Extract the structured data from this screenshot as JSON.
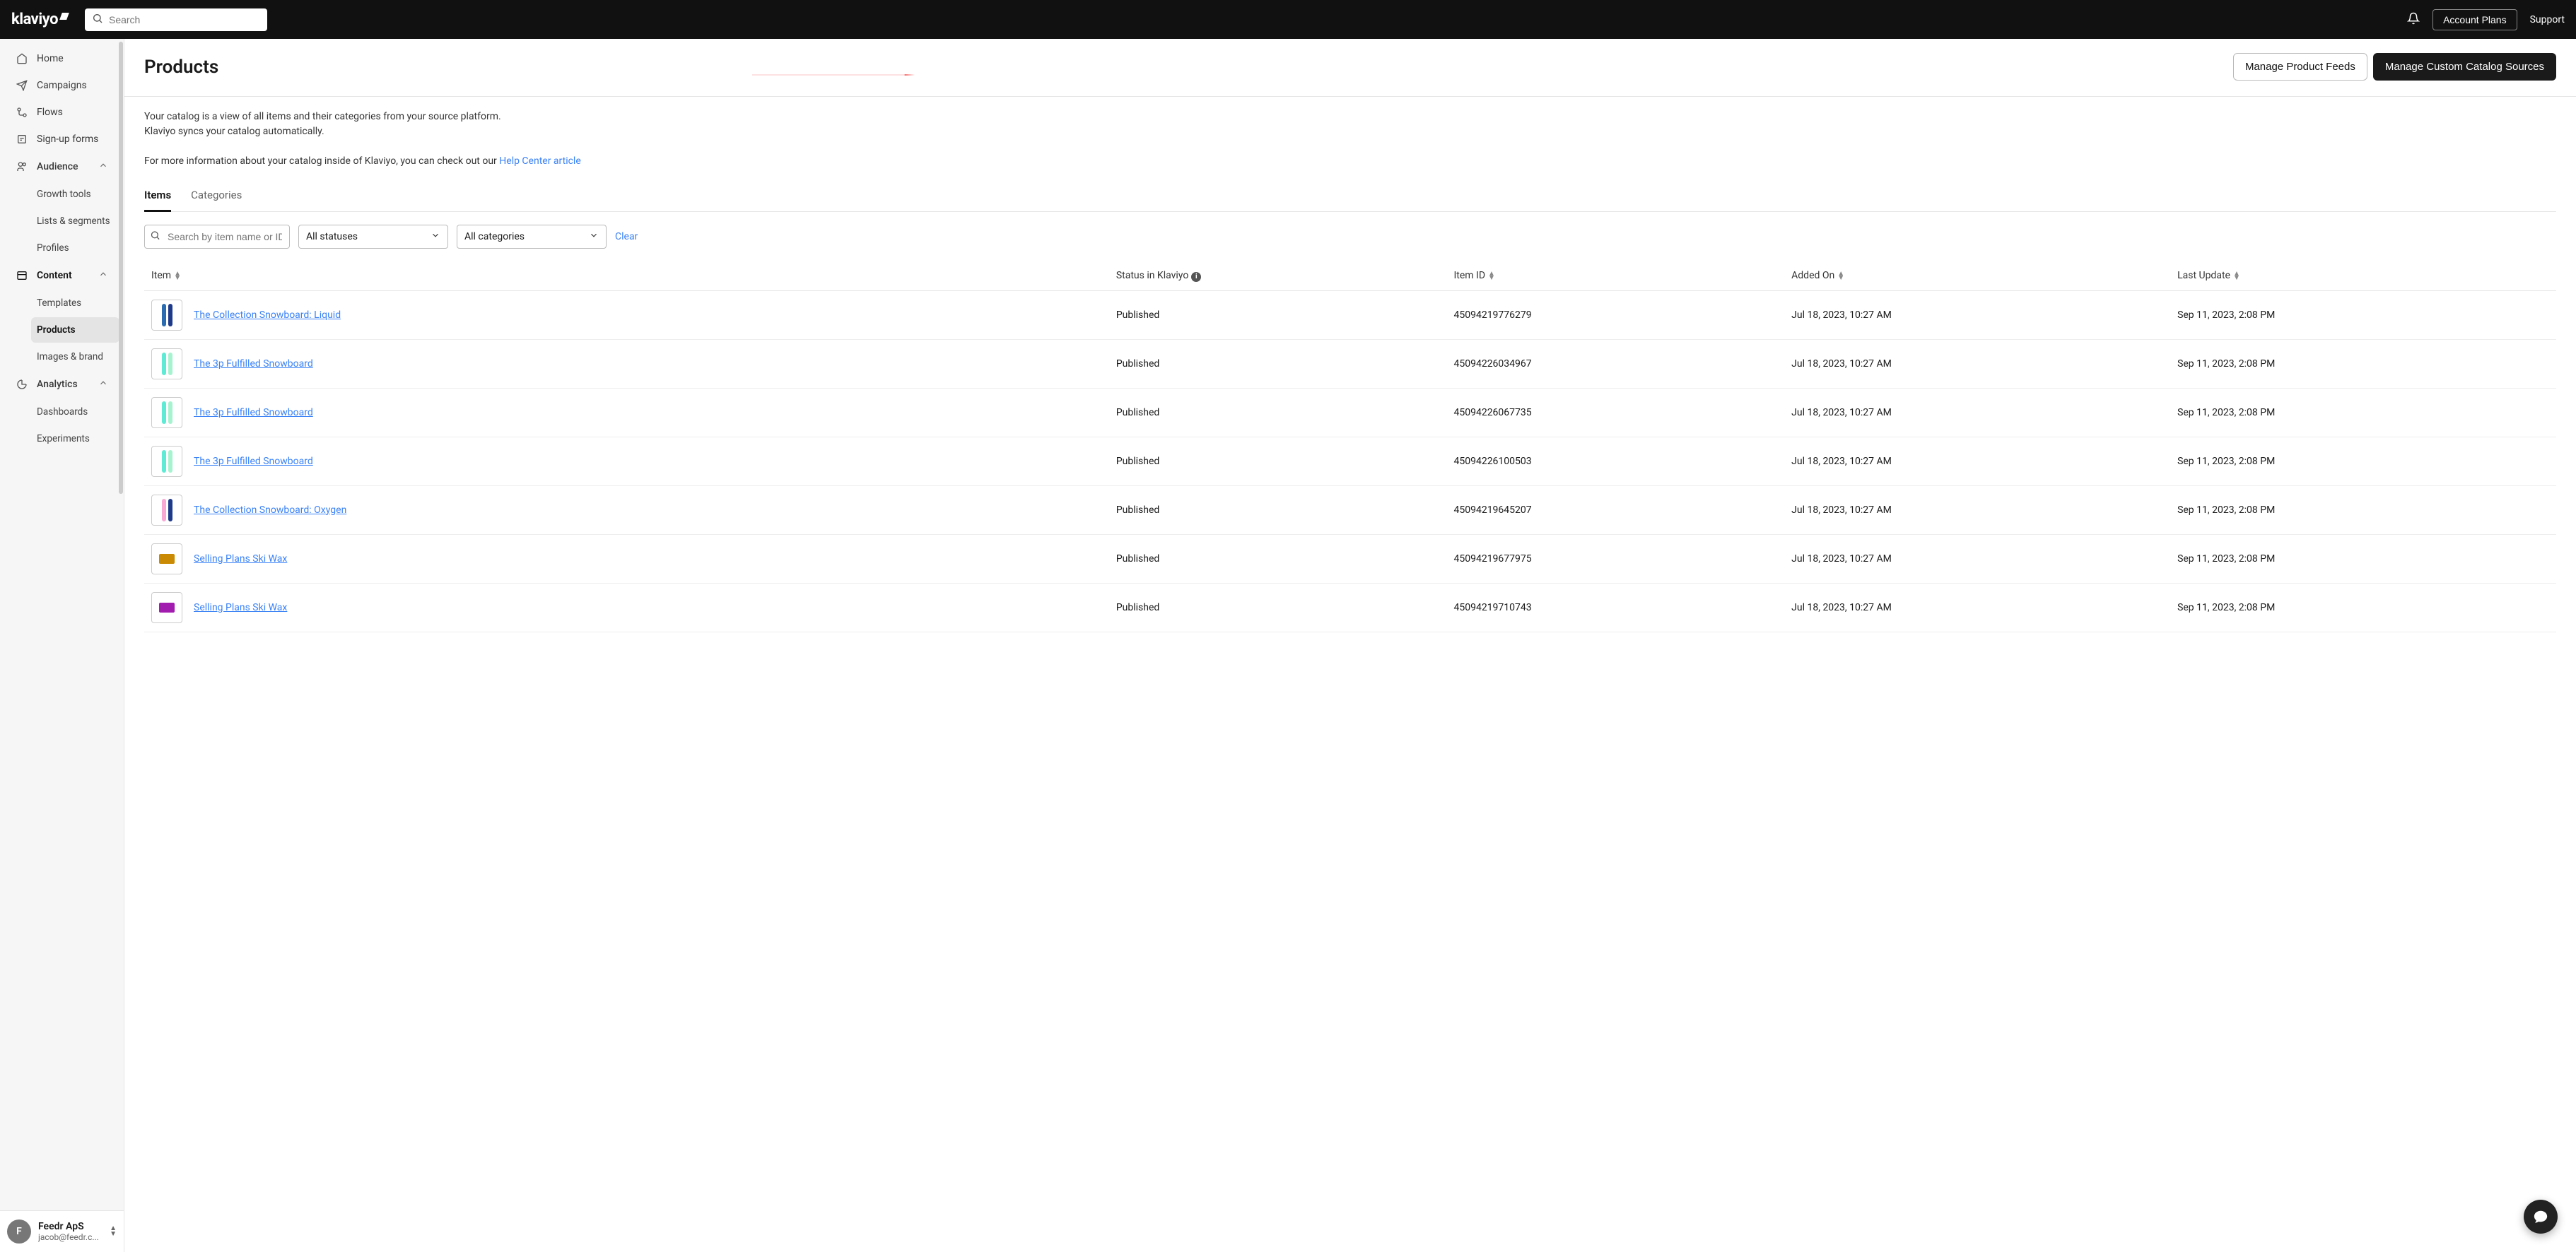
{
  "topbar": {
    "logo_text": "klaviyo",
    "search_placeholder": "Search",
    "account_plans": "Account Plans",
    "support": "Support"
  },
  "sidebar": {
    "items": [
      {
        "label": "Home",
        "icon": "home"
      },
      {
        "label": "Campaigns",
        "icon": "send"
      },
      {
        "label": "Flows",
        "icon": "flow"
      },
      {
        "label": "Sign-up forms",
        "icon": "form"
      }
    ],
    "audience": {
      "label": "Audience",
      "subs": [
        {
          "label": "Growth tools"
        },
        {
          "label": "Lists & segments"
        },
        {
          "label": "Profiles"
        }
      ]
    },
    "content": {
      "label": "Content",
      "subs": [
        {
          "label": "Templates"
        },
        {
          "label": "Products",
          "active": true
        },
        {
          "label": "Images & brand"
        }
      ]
    },
    "analytics": {
      "label": "Analytics",
      "subs": [
        {
          "label": "Dashboards"
        },
        {
          "label": "Experiments"
        }
      ]
    }
  },
  "account": {
    "initial": "F",
    "name": "Feedr ApS",
    "email": "jacob@feedr.c..."
  },
  "page": {
    "title": "Products",
    "btn_manage_feeds": "Manage Product Feeds",
    "btn_manage_sources": "Manage Custom Catalog Sources",
    "desc_line1": "Your catalog is a view of all items and their categories from your source platform.",
    "desc_line2": "Klaviyo syncs your catalog automatically.",
    "desc_line3_prefix": "For more information about your catalog inside of Klaviyo, you can check out our ",
    "desc_link": "Help Center article"
  },
  "tabs": {
    "items": "Items",
    "categories": "Categories"
  },
  "filters": {
    "search_placeholder": "Search by item name or ID",
    "status": "All statuses",
    "category": "All categories",
    "clear": "Clear"
  },
  "table": {
    "headers": {
      "item": "Item",
      "status": "Status in Klaviyo",
      "item_id": "Item ID",
      "added_on": "Added On",
      "last_update": "Last Update"
    },
    "rows": [
      {
        "name": "The Collection Snowboard: Liquid",
        "status": "Published",
        "item_id": "45094219776279",
        "added": "Jul 18, 2023, 10:27 AM",
        "updated": "Sep 11, 2023, 2:08 PM",
        "colors": [
          "#2b6cb0",
          "#1e3a8a"
        ]
      },
      {
        "name": "The 3p Fulfilled Snowboard",
        "status": "Published",
        "item_id": "45094226034967",
        "added": "Jul 18, 2023, 10:27 AM",
        "updated": "Sep 11, 2023, 2:08 PM",
        "colors": [
          "#5eead4",
          "#a7f3d0"
        ]
      },
      {
        "name": "The 3p Fulfilled Snowboard",
        "status": "Published",
        "item_id": "45094226067735",
        "added": "Jul 18, 2023, 10:27 AM",
        "updated": "Sep 11, 2023, 2:08 PM",
        "colors": [
          "#5eead4",
          "#a7f3d0"
        ]
      },
      {
        "name": "The 3p Fulfilled Snowboard",
        "status": "Published",
        "item_id": "45094226100503",
        "added": "Jul 18, 2023, 10:27 AM",
        "updated": "Sep 11, 2023, 2:08 PM",
        "colors": [
          "#5eead4",
          "#a7f3d0"
        ]
      },
      {
        "name": "The Collection Snowboard: Oxygen",
        "status": "Published",
        "item_id": "45094219645207",
        "added": "Jul 18, 2023, 10:27 AM",
        "updated": "Sep 11, 2023, 2:08 PM",
        "colors": [
          "#f9a8d4",
          "#1e3a8a"
        ]
      },
      {
        "name": "Selling Plans Ski Wax",
        "status": "Published",
        "item_id": "45094219677975",
        "added": "Jul 18, 2023, 10:27 AM",
        "updated": "Sep 11, 2023, 2:08 PM",
        "colors": [
          "#ca8a04"
        ],
        "shape": "box"
      },
      {
        "name": "Selling Plans Ski Wax",
        "status": "Published",
        "item_id": "45094219710743",
        "added": "Jul 18, 2023, 10:27 AM",
        "updated": "Sep 11, 2023, 2:08 PM",
        "colors": [
          "#a21caf"
        ],
        "shape": "box"
      }
    ]
  }
}
